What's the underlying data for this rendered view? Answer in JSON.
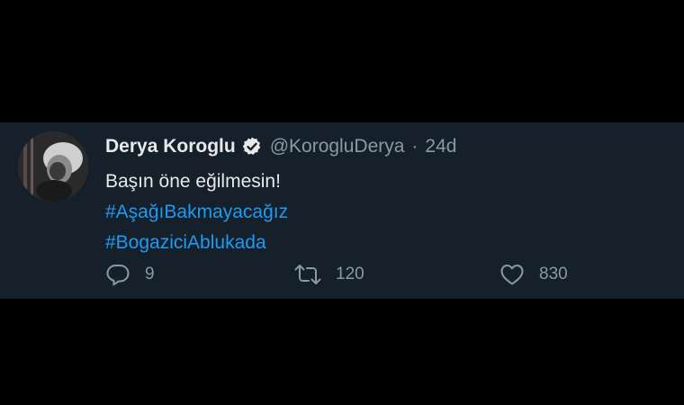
{
  "tweet": {
    "display_name": "Derya Koroglu",
    "handle": "@KorogluDerya",
    "separator": "·",
    "time": "24d",
    "text": "Başın öne eğilmesin!",
    "hashtags": [
      "#AşağıBakmayacağız",
      "#BogaziciAblukada"
    ],
    "reply_count": "9",
    "retweet_count": "120",
    "like_count": "830",
    "verified": true
  },
  "colors": {
    "background": "#000000",
    "card": "#15202b",
    "primary_text": "#e7e9ea",
    "secondary_text": "#8b98a5",
    "link": "#1d9bf0"
  },
  "icons": {
    "avatar": "profile-photo",
    "verified": "verified-badge-icon",
    "reply": "reply-bubble-icon",
    "retweet": "retweet-icon",
    "like": "heart-icon"
  }
}
